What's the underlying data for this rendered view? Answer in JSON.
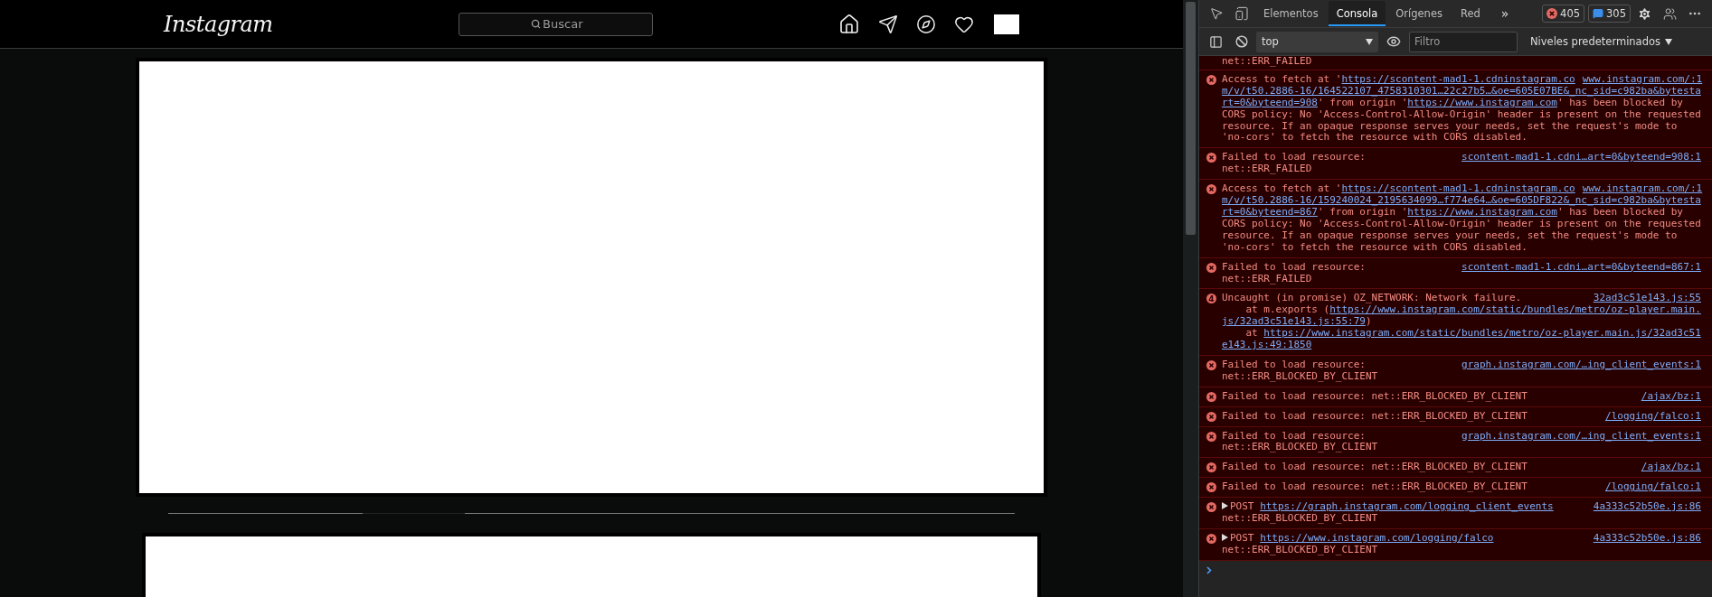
{
  "site": {
    "logo": "Instagram",
    "search": {
      "placeholder": "Buscar"
    }
  },
  "devtools": {
    "tabs": [
      {
        "label": "Elementos",
        "selected": false
      },
      {
        "label": "Consola",
        "selected": true
      },
      {
        "label": "Orígenes",
        "selected": false
      },
      {
        "label": "Red",
        "selected": false
      }
    ],
    "more_tabs": "»",
    "errors_count": "405",
    "messages_count": "305",
    "toolbar": {
      "context": "top",
      "filter": {
        "placeholder": "Filtro"
      },
      "levels": "Niveles predeterminados"
    },
    "messages": [
      {
        "kind": "continuation",
        "lines": [
          [
            {
              "t": "net::ERR_FAILED"
            }
          ]
        ]
      },
      {
        "kind": "error",
        "source": "www.instagram.com/:1",
        "lines": [
          [
            {
              "t": "Access to fetch at '"
            },
            {
              "t": "https://scontent-mad1-1.cdninstagram.co",
              "link": true
            }
          ],
          [
            {
              "t": "m/v/t50.2886-16/164522107_4758310301…22c27b5…&oe=605E07BE&_nc_sid=c982ba&bytesta",
              "link": true
            }
          ],
          [
            {
              "t": "rt=0&byteend=908",
              "link": true
            },
            {
              "t": "' from origin '"
            },
            {
              "t": "https://www.instagram.com",
              "link": true
            },
            {
              "t": "' has been blocked by"
            }
          ],
          [
            {
              "t": "CORS policy: No 'Access-Control-Allow-Origin' header is present on the requested"
            }
          ],
          [
            {
              "t": "resource. If an opaque response serves your needs, set the request's mode to"
            }
          ],
          [
            {
              "t": "'no-cors' to fetch the resource with CORS disabled."
            }
          ]
        ]
      },
      {
        "kind": "error",
        "source": "scontent-mad1-1.cdni…art=0&byteend=908:1",
        "lines": [
          [
            {
              "t": "Failed to load resource:"
            }
          ],
          [
            {
              "t": "net::ERR_FAILED"
            }
          ]
        ]
      },
      {
        "kind": "error",
        "source": "www.instagram.com/:1",
        "lines": [
          [
            {
              "t": "Access to fetch at '"
            },
            {
              "t": "https://scontent-mad1-1.cdninstagram.co",
              "link": true
            }
          ],
          [
            {
              "t": "m/v/t50.2886-16/159240024_2195634099…f774e64…&oe=605DF822&_nc_sid=c982ba&bytesta",
              "link": true
            }
          ],
          [
            {
              "t": "rt=0&byteend=867",
              "link": true
            },
            {
              "t": "' from origin '"
            },
            {
              "t": "https://www.instagram.com",
              "link": true
            },
            {
              "t": "' has been blocked by"
            }
          ],
          [
            {
              "t": "CORS policy: No 'Access-Control-Allow-Origin' header is present on the requested"
            }
          ],
          [
            {
              "t": "resource. If an opaque response serves your needs, set the request's mode to"
            }
          ],
          [
            {
              "t": "'no-cors' to fetch the resource with CORS disabled."
            }
          ]
        ]
      },
      {
        "kind": "error",
        "source": "scontent-mad1-1.cdni…art=0&byteend=867:1",
        "lines": [
          [
            {
              "t": "Failed to load resource:"
            }
          ],
          [
            {
              "t": "net::ERR_FAILED"
            }
          ]
        ]
      },
      {
        "kind": "uncaught",
        "count": "4",
        "source": "32ad3c51e143.js:55",
        "lines": [
          [
            {
              "t": "Uncaught (in promise) OZ_NETWORK: Network failure."
            }
          ],
          [
            {
              "t": "    at m.exports ("
            },
            {
              "t": "https://www.instagram.com/static/bundles/metro/oz-player.main.",
              "link": true
            }
          ],
          [
            {
              "t": "js/32ad3c51e143.js:55:79",
              "link": true
            },
            {
              "t": ")"
            }
          ],
          [
            {
              "t": "    at "
            },
            {
              "t": "https://www.instagram.com/static/bundles/metro/oz-player.main.js/32ad3c51",
              "link": true
            }
          ],
          [
            {
              "t": "e143.js:49:1850",
              "link": true
            }
          ]
        ]
      },
      {
        "kind": "error",
        "source": "graph.instagram.com/…ing_client_events:1",
        "lines": [
          [
            {
              "t": "Failed to load resource:"
            }
          ],
          [
            {
              "t": "net::ERR_BLOCKED_BY_CLIENT"
            }
          ]
        ]
      },
      {
        "kind": "error",
        "source": "/ajax/bz:1",
        "lines": [
          [
            {
              "t": "Failed to load resource: net::ERR_BLOCKED_BY_CLIENT"
            }
          ]
        ]
      },
      {
        "kind": "error",
        "source": "/logging/falco:1",
        "lines": [
          [
            {
              "t": "Failed to load resource: net::ERR_BLOCKED_BY_CLIENT"
            }
          ]
        ]
      },
      {
        "kind": "error",
        "source": "graph.instagram.com/…ing_client_events:1",
        "lines": [
          [
            {
              "t": "Failed to load resource:"
            }
          ],
          [
            {
              "t": "net::ERR_BLOCKED_BY_CLIENT"
            }
          ]
        ]
      },
      {
        "kind": "error",
        "source": "/ajax/bz:1",
        "lines": [
          [
            {
              "t": "Failed to load resource: net::ERR_BLOCKED_BY_CLIENT"
            }
          ]
        ]
      },
      {
        "kind": "error",
        "source": "/logging/falco:1",
        "lines": [
          [
            {
              "t": "Failed to load resource: net::ERR_BLOCKED_BY_CLIENT"
            }
          ]
        ]
      },
      {
        "kind": "post",
        "source": "4a333c52b50e.js:86",
        "lines": [
          [
            {
              "t": "POST "
            },
            {
              "t": "https://graph.instagram.com/logging_client_events",
              "link": true
            }
          ],
          [
            {
              "t": "net::ERR_BLOCKED_BY_CLIENT"
            }
          ]
        ]
      },
      {
        "kind": "post",
        "source": "4a333c52b50e.js:86",
        "lines": [
          [
            {
              "t": "POST "
            },
            {
              "t": "https://www.instagram.com/logging/falco",
              "link": true
            }
          ],
          [
            {
              "t": "net::ERR_BLOCKED_BY_CLIENT"
            }
          ]
        ]
      }
    ]
  }
}
